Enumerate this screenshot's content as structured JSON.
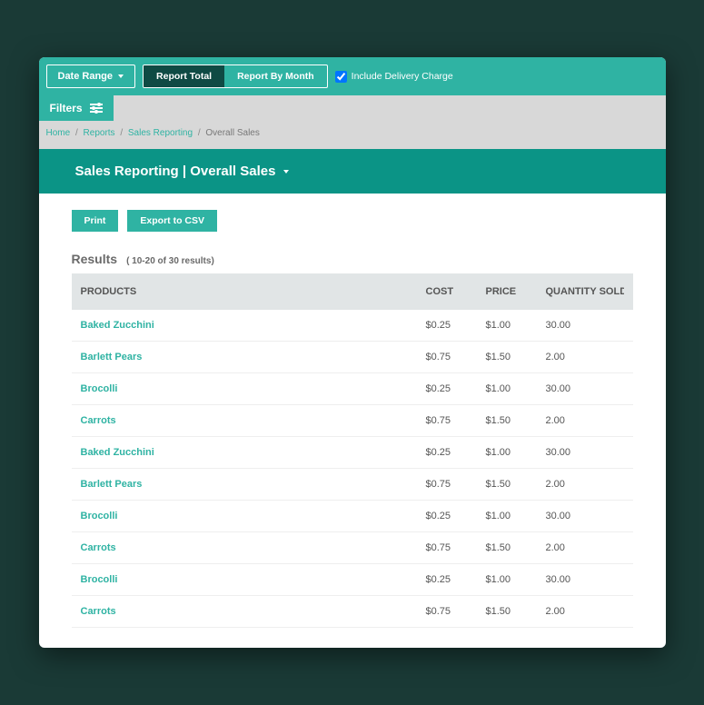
{
  "toolbar": {
    "date_range_label": "Date Range",
    "tab_total": "Report Total",
    "tab_month": "Report By Month",
    "delivery_label": "Include Delivery Charge"
  },
  "filters_label": "Filters",
  "breadcrumb": {
    "home": "Home",
    "reports": "Reports",
    "sales_reporting": "Sales Reporting",
    "current": "Overall Sales"
  },
  "title": "Sales Reporting | Overall Sales",
  "actions": {
    "print": "Print",
    "export": "Export to CSV"
  },
  "results": {
    "heading": "Results",
    "count_text": "( 10-20 of 30 results)",
    "columns": {
      "products": "PRODUCTS",
      "cost": "COST",
      "price": "PRICE",
      "qty": "QUANTITY SOLD"
    },
    "rows": [
      {
        "product": "Baked Zucchini",
        "cost": "$0.25",
        "price": "$1.00",
        "qty": "30.00"
      },
      {
        "product": "Barlett Pears",
        "cost": "$0.75",
        "price": "$1.50",
        "qty": "2.00"
      },
      {
        "product": "Brocolli",
        "cost": "$0.25",
        "price": "$1.00",
        "qty": "30.00"
      },
      {
        "product": "Carrots",
        "cost": "$0.75",
        "price": "$1.50",
        "qty": "2.00"
      },
      {
        "product": "Baked Zucchini",
        "cost": "$0.25",
        "price": "$1.00",
        "qty": "30.00"
      },
      {
        "product": "Barlett Pears",
        "cost": "$0.75",
        "price": "$1.50",
        "qty": "2.00"
      },
      {
        "product": "Brocolli",
        "cost": "$0.25",
        "price": "$1.00",
        "qty": "30.00"
      },
      {
        "product": "Carrots",
        "cost": "$0.75",
        "price": "$1.50",
        "qty": "2.00"
      },
      {
        "product": "Brocolli",
        "cost": "$0.25",
        "price": "$1.00",
        "qty": "30.00"
      },
      {
        "product": "Carrots",
        "cost": "$0.75",
        "price": "$1.50",
        "qty": "2.00"
      }
    ]
  }
}
